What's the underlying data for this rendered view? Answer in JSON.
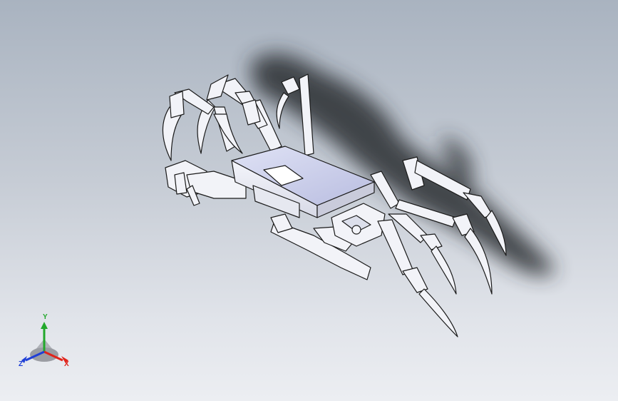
{
  "viewport": {
    "background_top": "#a9b3c0",
    "background_bottom": "#eceef2"
  },
  "model": {
    "description_icon": "robotic-spider-assembly",
    "part_fill": "#f2f3f8",
    "part_edge": "#1a1a1a",
    "shadow_color": "#2a2d33"
  },
  "triad": {
    "x_label": "X",
    "y_label": "Y",
    "z_label": "Z",
    "x_color": "#e0241b",
    "y_color": "#22a82b",
    "z_color": "#1f3fd6"
  }
}
